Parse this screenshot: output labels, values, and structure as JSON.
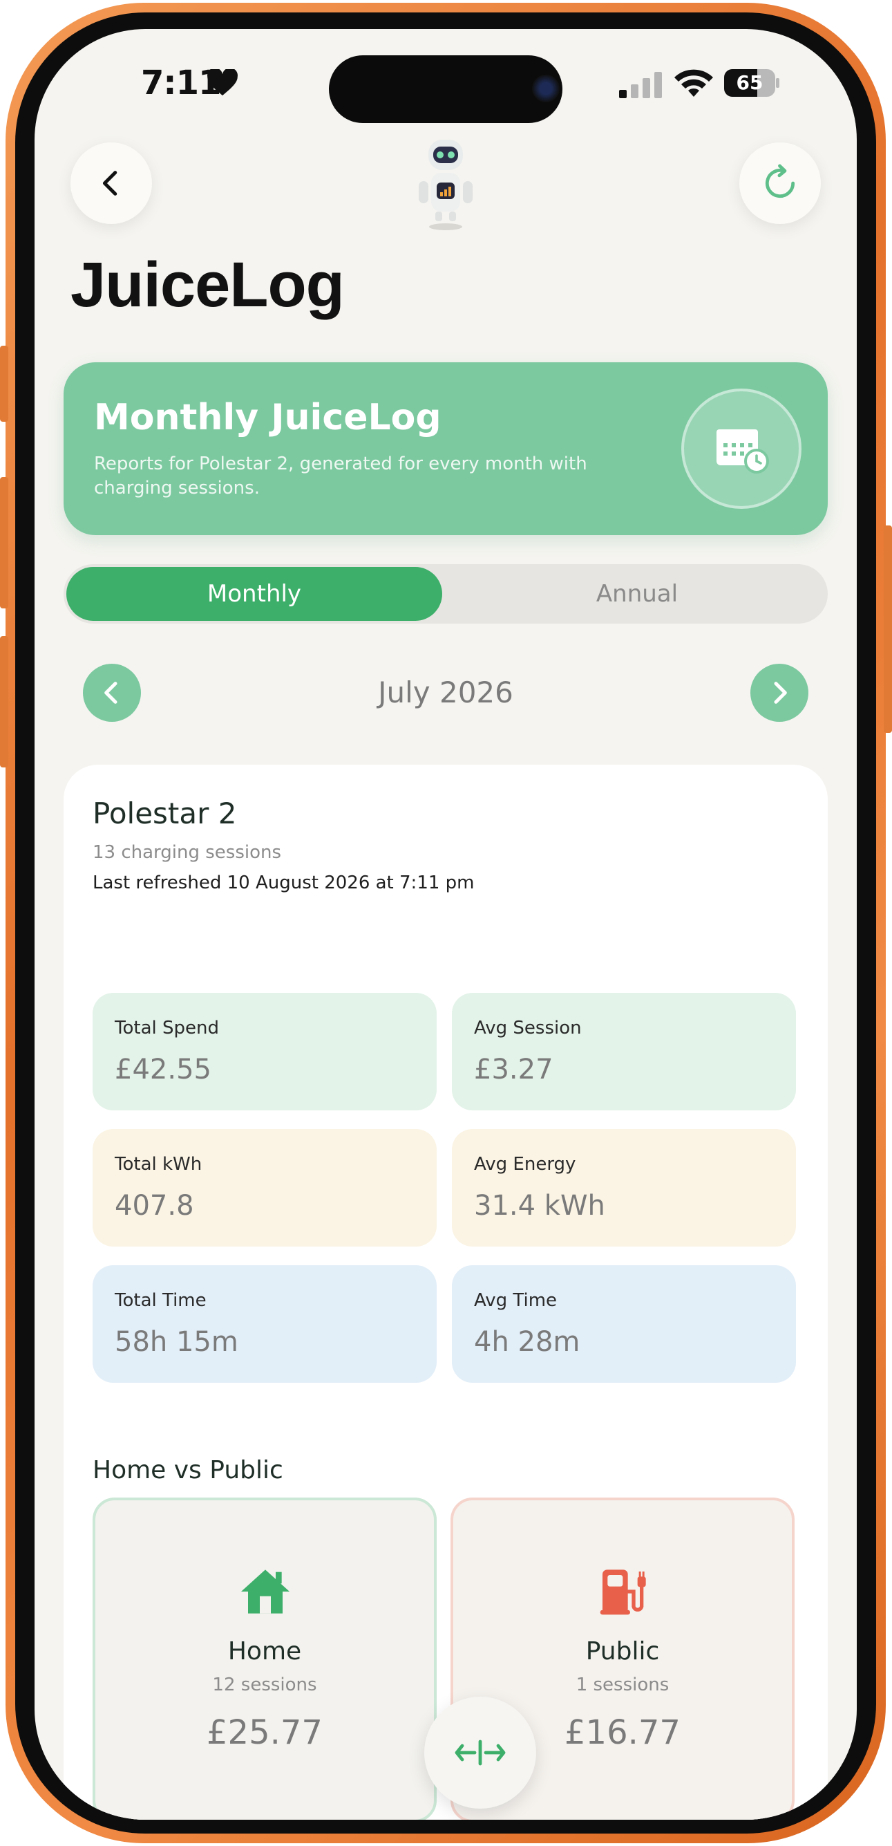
{
  "status_bar": {
    "time": "7:11",
    "battery": "65",
    "battery_level": 0.65
  },
  "header": {
    "title": "JuiceLog"
  },
  "banner": {
    "title": "Monthly JuiceLog",
    "subtitle": "Reports for Polestar 2, generated for every month with charging sessions."
  },
  "tabs": [
    {
      "label": "Monthly",
      "active": true
    },
    {
      "label": "Annual",
      "active": false
    }
  ],
  "period": {
    "label": "July 2026"
  },
  "report": {
    "vehicle": "Polestar 2",
    "sessions": "13 charging sessions",
    "refreshed": "Last refreshed 10 August 2026 at 7:11 pm",
    "stats": [
      {
        "label": "Total Spend",
        "value": "£42.55"
      },
      {
        "label": "Avg Session",
        "value": "£3.27"
      },
      {
        "label": "Total kWh",
        "value": "407.8"
      },
      {
        "label": "Avg Energy",
        "value": "31.4 kWh"
      },
      {
        "label": "Total Time",
        "value": "58h 15m"
      },
      {
        "label": "Avg Time",
        "value": "4h 28m"
      }
    ],
    "split": {
      "title": "Home vs Public",
      "home": {
        "label": "Home",
        "sessions": "12 sessions",
        "value": "£25.77"
      },
      "public": {
        "label": "Public",
        "sessions": "1 sessions",
        "value": "£16.77"
      }
    }
  },
  "colors": {
    "accent": "#3daf6a",
    "accent_light": "#7cc9a0",
    "spend_bg": "#e3f3e9",
    "energy_bg": "#fbf4e4",
    "time_bg": "#e2eef8",
    "home_icon": "#3daf6a",
    "public_icon": "#e8604a",
    "frame": "#e4712c"
  },
  "icons": {
    "back": "chevron-left-icon",
    "refresh": "refresh-icon",
    "mascot": "robot-mascot",
    "banner": "calendar-clock-icon",
    "home": "house-icon",
    "public": "fuel-pump-icon",
    "compare": "arrows-left-right-icon"
  }
}
